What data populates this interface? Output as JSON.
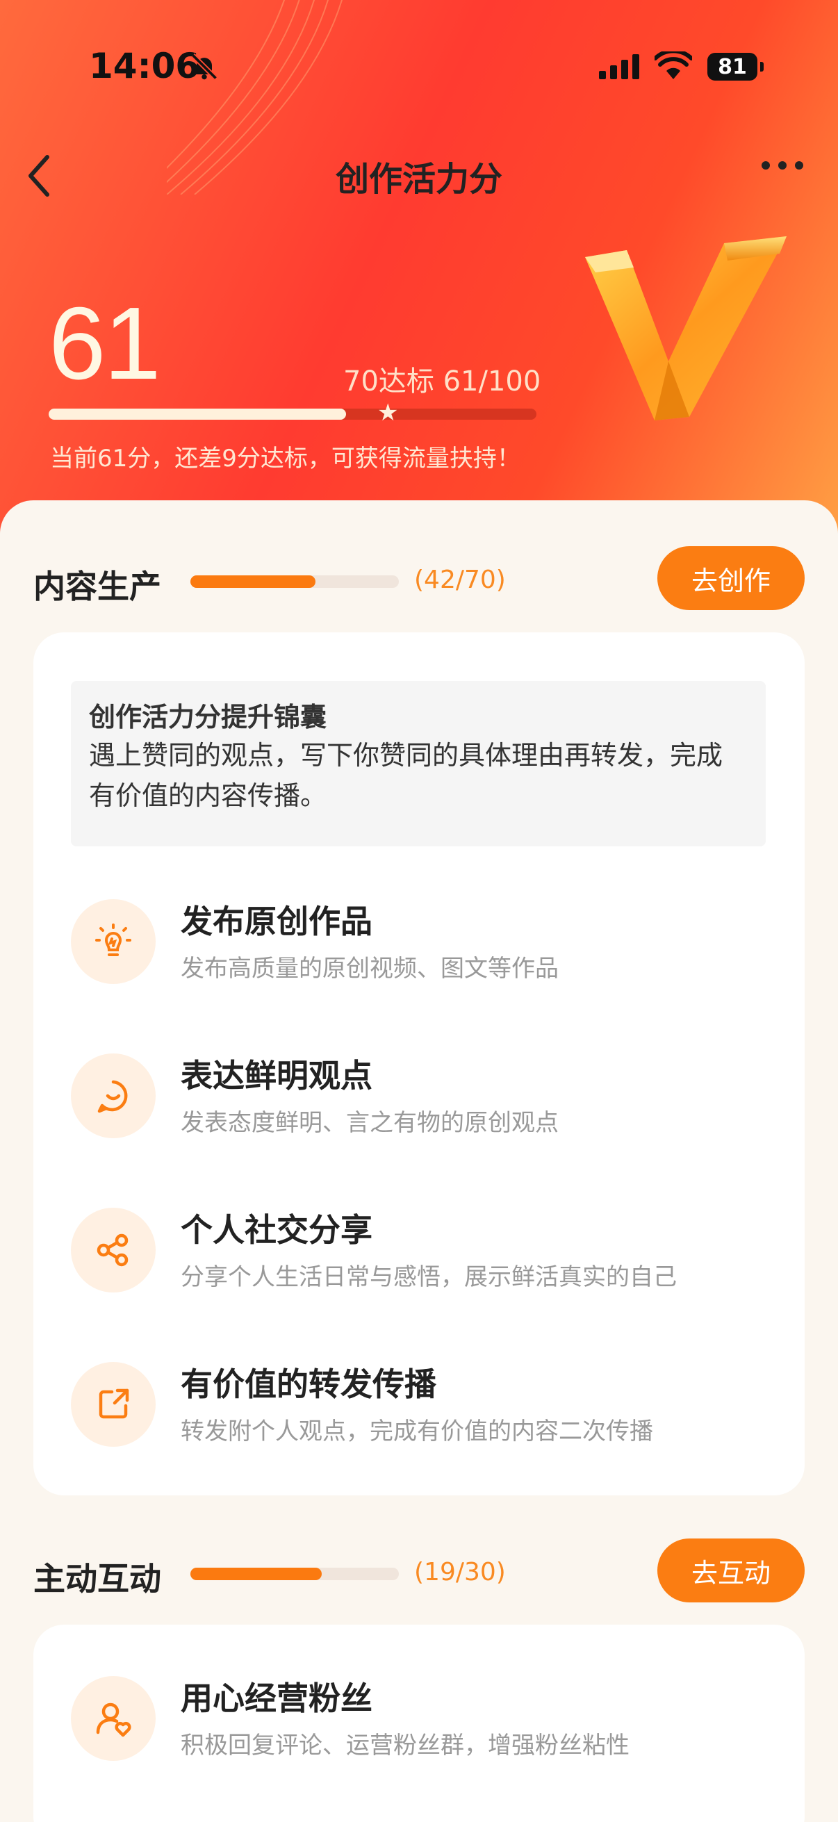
{
  "status_bar": {
    "time": "14:06",
    "battery": "81"
  },
  "nav": {
    "title": "创作活力分"
  },
  "hero": {
    "score": "61",
    "target_text": "70达标 61/100",
    "progress": 0.61,
    "hint": "当前61分，还差9分达标，可获得流量扶持！"
  },
  "sections": [
    {
      "title": "内容生产",
      "progress": 0.6,
      "count": "(42/70)",
      "button": "去创作",
      "tip": {
        "title": "创作活力分提升锦囊",
        "body": "遇上赞同的观点，写下你赞同的具体理由再转发，完成有价值的内容传播。"
      },
      "items": [
        {
          "icon": "lightbulb-icon",
          "title": "发布原创作品",
          "desc": "发布高质量的原创视频、图文等作品"
        },
        {
          "icon": "chat-smile-icon",
          "title": "表达鲜明观点",
          "desc": "发表态度鲜明、言之有物的原创观点"
        },
        {
          "icon": "share-icon",
          "title": "个人社交分享",
          "desc": "分享个人生活日常与感悟，展示鲜活真实的自己"
        },
        {
          "icon": "forward-icon",
          "title": "有价值的转发传播",
          "desc": "转发附个人观点，完成有价值的内容二次传播"
        }
      ]
    },
    {
      "title": "主动互动",
      "progress": 0.63,
      "count": "(19/30)",
      "button": "去互动",
      "items": [
        {
          "icon": "fans-heart-icon",
          "title": "用心经营粉丝",
          "desc": "积极回复评论、运营粉丝群，增强粉丝粘性"
        }
      ]
    }
  ],
  "colors": {
    "accent": "#fb7d12",
    "hero_red": "#ff3b30"
  }
}
